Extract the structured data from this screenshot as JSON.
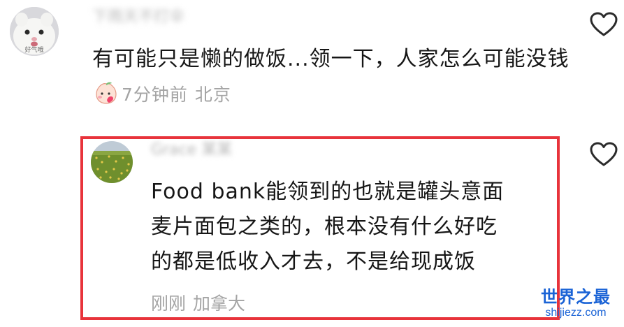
{
  "comments": [
    {
      "username": "下雨天不打伞",
      "avatar_badge": "好气哦",
      "body": "有可能只是懒的做饭...领一下，人家怎么可能没钱",
      "emoji": "blushing-peach-emoji",
      "time": "7分钟前",
      "location": "北京",
      "like_icon": "heart-outline-icon"
    },
    {
      "username": "Grace 某某",
      "avatar": "grass-field-avatar",
      "body_lines": [
        "Food bank能领到的也就是罐头意面",
        "麦片面包之类的，根本没有什么好吃",
        "的都是低收入才去，不是给现成饭"
      ],
      "time": "刚刚",
      "location": "加拿大",
      "like_icon": "heart-outline-icon"
    }
  ],
  "highlight": {
    "color": "#e8333b"
  },
  "watermark": {
    "title": "世界之最",
    "domain": "shijiezz.com",
    "color": "#1a63d6"
  }
}
